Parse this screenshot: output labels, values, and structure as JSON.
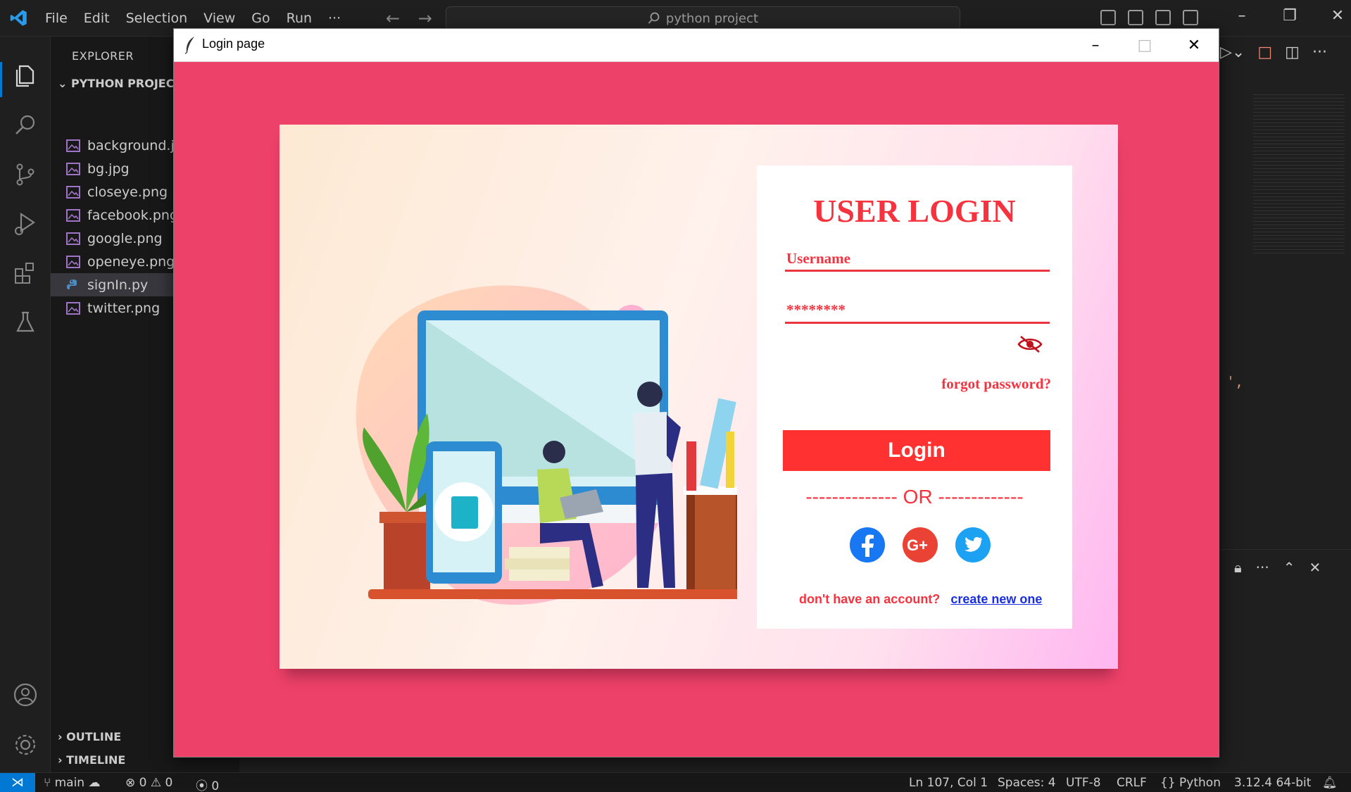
{
  "menubar": {
    "items": [
      "File",
      "Edit",
      "Selection",
      "View",
      "Go",
      "Run",
      "···"
    ]
  },
  "command_center": {
    "text": "python project"
  },
  "explorer": {
    "title": "EXPLORER",
    "project": "PYTHON PROJECT",
    "files": [
      {
        "name": "background.jpg",
        "type": "image"
      },
      {
        "name": "bg.jpg",
        "type": "image"
      },
      {
        "name": "closeye.png",
        "type": "image"
      },
      {
        "name": "facebook.png",
        "type": "image"
      },
      {
        "name": "google.png",
        "type": "image"
      },
      {
        "name": "openeye.png",
        "type": "image"
      },
      {
        "name": "signIn.py",
        "type": "python",
        "active": true
      },
      {
        "name": "twitter.png",
        "type": "image"
      }
    ],
    "outline": "OUTLINE",
    "timeline": "TIMELINE"
  },
  "editor": {
    "code_fragment": "',"
  },
  "statusbar": {
    "branch": "main",
    "errors": "0",
    "warnings": "0",
    "ports": "0",
    "position": "Ln 107, Col 1",
    "spaces": "Spaces: 4",
    "encoding": "UTF-8",
    "eol": "CRLF",
    "language": "Python",
    "interpreter": "3.12.4 64-bit"
  },
  "login_window": {
    "title": "Login page",
    "heading": "USER LOGIN",
    "username_label": "Username",
    "password_mask": "********",
    "forgot": "forgot password?",
    "login_button": "Login",
    "or_divider": "-------------- OR -------------",
    "signup_question": "don't have an account?",
    "signup_link": "create new one"
  },
  "colors": {
    "window_bg": "#ee4169",
    "accent_red": "#f5333f",
    "button_red": "#ff3131",
    "link_blue": "#1a2fe0",
    "vscode_blue": "#0078d4"
  }
}
